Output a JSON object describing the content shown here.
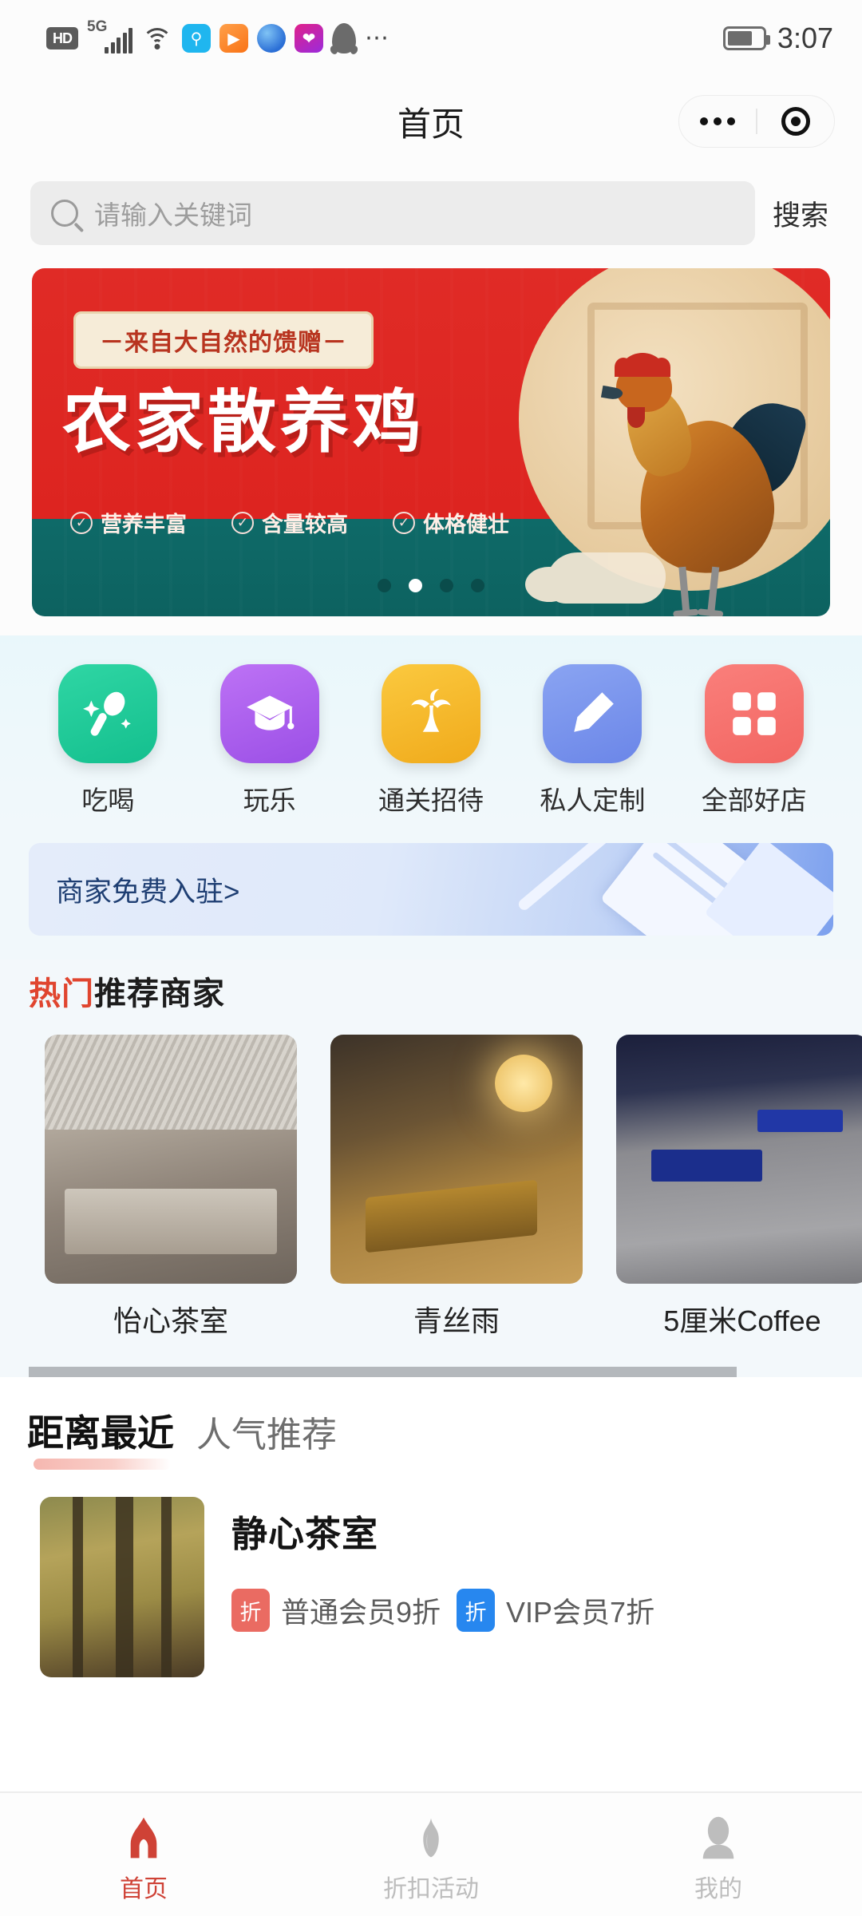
{
  "status_bar": {
    "hd_label": "HD",
    "network_label": "5G",
    "icons": [
      "hd-badge",
      "signal-bars-icon",
      "wifi-icon",
      "search-app-icon",
      "video-app-icon",
      "browser-app-icon",
      "heart-app-icon",
      "qq-app-icon",
      "more-dots-icon"
    ],
    "battery_icon": "battery-icon",
    "time": "3:07"
  },
  "nav": {
    "title": "首页",
    "capsule": {
      "menu_icon": "more-dots-icon",
      "target_icon": "target-icon"
    }
  },
  "search": {
    "icon": "search-icon",
    "placeholder": "请输入关键词",
    "value": "",
    "button_label": "搜索"
  },
  "banner": {
    "subtitle": "－来自大自然的馈赠－",
    "title": "农家散养鸡",
    "features": [
      "营养丰富",
      "含量较高",
      "体格健壮"
    ],
    "dot_count": 4,
    "active_dot": 1,
    "colors": {
      "red": "#dd2420",
      "teal": "#0e6a68",
      "cream": "#f6ecd8"
    }
  },
  "categories": [
    {
      "label": "吃喝",
      "icon": "spoon-icon",
      "color": "#16c08f"
    },
    {
      "label": "玩乐",
      "icon": "graduation-cap-icon",
      "color": "#9b4fe6"
    },
    {
      "label": "通关招待",
      "icon": "palm-tree-icon",
      "color": "#f0aa1b"
    },
    {
      "label": "私人定制",
      "icon": "pen-icon",
      "color": "#6b86e8"
    },
    {
      "label": "全部好店",
      "icon": "grid-icon",
      "color": "#f26662"
    }
  ],
  "join_banner": {
    "label": "商家免费入驻>",
    "accent": "#7ca0ee"
  },
  "hot_section": {
    "title_highlight": "热门",
    "title_rest": "推荐商家",
    "highlight_color": "#e0452f",
    "shops": [
      {
        "name": "怡心茶室",
        "image": "tea-room-interior"
      },
      {
        "name": "青丝雨",
        "image": "restaurant-interior"
      },
      {
        "name": "5厘米Coffee",
        "image": "coffee-shop-entrance"
      }
    ]
  },
  "near_section": {
    "tabs": [
      {
        "label": "距离最近",
        "active": true
      },
      {
        "label": "人气推荐",
        "active": false
      }
    ],
    "underline_color": "#f6b7b0",
    "items": [
      {
        "name": "静心茶室",
        "image": "forest-photo",
        "badges": [
          {
            "mark": "折",
            "text": "普通会员9折",
            "color": "#ea6b62"
          },
          {
            "mark": "折",
            "text": "VIP会员7折",
            "color": "#2787ef"
          }
        ]
      }
    ]
  },
  "tabbar": {
    "active_color": "#cf4236",
    "inactive_color": "#bdbdbd",
    "items": [
      {
        "label": "首页",
        "icon": "home-icon",
        "active": true
      },
      {
        "label": "折扣活动",
        "icon": "flame-icon",
        "active": false
      },
      {
        "label": "我的",
        "icon": "person-icon",
        "active": false
      }
    ]
  }
}
